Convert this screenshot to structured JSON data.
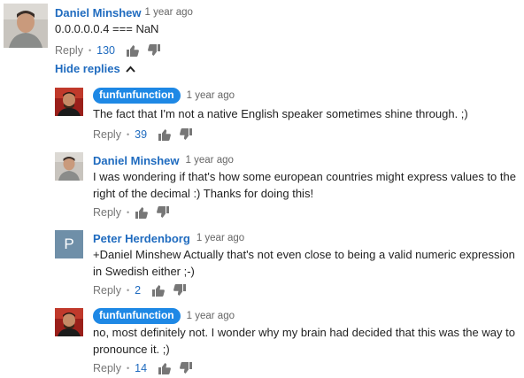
{
  "ui": {
    "reply_label": "Reply",
    "hide_replies_label": "Hide replies",
    "bullet": "•"
  },
  "comments": [
    {
      "author": "Daniel Minshew",
      "time": "1 year ago",
      "text": "0.0.0.0.0.4 === NaN",
      "likes": "130"
    }
  ],
  "replies": [
    {
      "author": "funfunfunction",
      "time": "1 year ago",
      "text": "The fact that I'm not a native English speaker sometimes shine through. ;)",
      "likes": "39"
    },
    {
      "author": "Daniel Minshew",
      "time": "1 year ago",
      "text": "I was wondering if that's how some european countries might express values to the right of the decimal :) Thanks for doing this!",
      "likes": ""
    },
    {
      "author": "Peter Herdenborg",
      "avatar_initial": "P",
      "time": "1 year ago",
      "text": "+Daniel Minshew Actually that's not even close to being a valid numeric expression in Swedish either ;-)",
      "likes": "2"
    },
    {
      "author": "funfunfunction",
      "time": "1 year ago",
      "text": "no, most definitely not. I wonder why my brain had decided that this was the way to pronounce it. ;)",
      "likes": "14"
    }
  ]
}
